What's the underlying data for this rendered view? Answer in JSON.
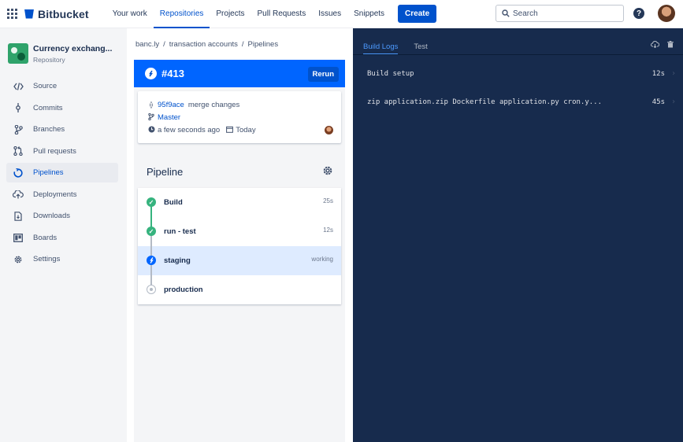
{
  "topbar": {
    "product": "Bitbucket",
    "nav": [
      "Your work",
      "Repositories",
      "Projects",
      "Pull Requests",
      "Issues",
      "Snippets"
    ],
    "active_nav": "Repositories",
    "create_label": "Create",
    "search_placeholder": "Search",
    "help_glyph": "?"
  },
  "sidebar": {
    "repo_name": "Currency exchang...",
    "repo_type": "Repository",
    "items": [
      {
        "label": "Source",
        "icon": "code-icon"
      },
      {
        "label": "Commits",
        "icon": "commit-icon"
      },
      {
        "label": "Branches",
        "icon": "branch-icon"
      },
      {
        "label": "Pull requests",
        "icon": "pull-request-icon"
      },
      {
        "label": "Pipelines",
        "icon": "pipelines-icon",
        "active": true
      },
      {
        "label": "Deployments",
        "icon": "cloud-upload-icon"
      },
      {
        "label": "Downloads",
        "icon": "file-download-icon"
      },
      {
        "label": "Boards",
        "icon": "board-icon"
      },
      {
        "label": "Settings",
        "icon": "gear-icon"
      }
    ]
  },
  "breadcrumb": [
    "banc.ly",
    "transaction accounts",
    "Pipelines"
  ],
  "build": {
    "number": "#413",
    "rerun_label": "Rerun",
    "commit_hash": "95f9ace",
    "commit_message": "merge changes",
    "branch": "Master",
    "time_ago": "a few seconds ago",
    "date": "Today"
  },
  "pipeline": {
    "title": "Pipeline",
    "steps": [
      {
        "name": "Build",
        "status": "success",
        "duration": "25s"
      },
      {
        "name": "run - test",
        "status": "success",
        "duration": "12s"
      },
      {
        "name": "staging",
        "status": "running",
        "duration": "working"
      },
      {
        "name": "production",
        "status": "pending",
        "duration": ""
      }
    ]
  },
  "logs": {
    "tabs": [
      "Build Logs",
      "Test"
    ],
    "active_tab": "Build Logs",
    "rows": [
      {
        "text": "Build setup",
        "time": "12s"
      },
      {
        "text": "zip application.zip Dockerfile application.py cron.y...",
        "time": "45s"
      }
    ]
  },
  "colors": {
    "brand": "#0052cc",
    "header_blue": "#0065ff",
    "success": "#36b37e",
    "log_bg": "#172b4d"
  }
}
